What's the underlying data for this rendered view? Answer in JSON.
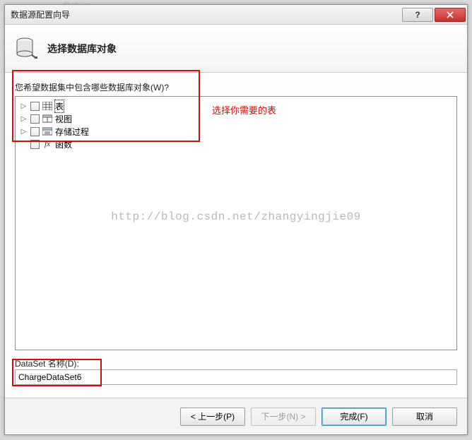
{
  "window": {
    "title": "数据源配置向导",
    "help_aria": "帮助",
    "close_aria": "关闭"
  },
  "header": {
    "title": "选择数据库对象"
  },
  "prompt": "您希望数据集中包含哪些数据库对象(W)?",
  "tree": {
    "items": [
      {
        "label": "表",
        "icon": "table-grid",
        "expandable": true,
        "selected": true
      },
      {
        "label": "视图",
        "icon": "view",
        "expandable": true,
        "selected": false
      },
      {
        "label": "存储过程",
        "icon": "stored-proc",
        "expandable": true,
        "selected": false
      },
      {
        "label": "函数",
        "icon": "function-fx",
        "expandable": false,
        "selected": false
      }
    ]
  },
  "watermark": "http://blog.csdn.net/zhangyingjie09",
  "dataset": {
    "label": "DataSet 名称(D):",
    "value": "ChargeDataSet6"
  },
  "buttons": {
    "prev": "< 上一步(P)",
    "next": "下一步(N) >",
    "finish": "完成(F)",
    "cancel": "取消"
  },
  "annotation_text": "选择你需要的表",
  "bg_hint": "Debug"
}
